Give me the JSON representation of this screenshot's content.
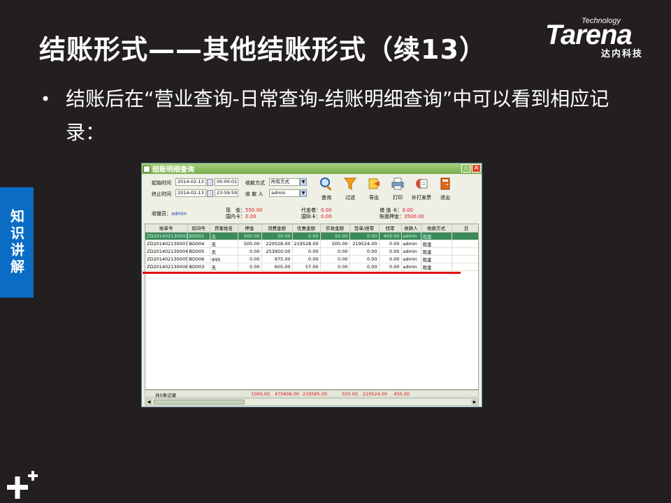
{
  "slide": {
    "title": "结账形式——其他结账形式（续13）",
    "bullet": "结账后在“营业查询-日常查询-结账明细查询”中可以看到相应记录：",
    "side_tab": "知识讲解"
  },
  "logo": {
    "tagline": "Technology",
    "wordmark": "Tarena",
    "cn": "达内科技"
  },
  "window": {
    "title": "结账明细查询",
    "filters": {
      "start_label": "起始时间",
      "start_date": "2014-02-13",
      "start_time": "00:00:01",
      "end_label": "终止时间",
      "end_date": "2014-02-13",
      "end_time": "23:59:59",
      "pay_method_label": "收款方式",
      "pay_method_value": "所有方式",
      "payee_label": "收 款 人",
      "payee_value": "admin",
      "cashier_label": "收银员：",
      "cashier_value": "admin"
    },
    "toolbar": [
      {
        "label": "查询",
        "icon": "magnifier-icon"
      },
      {
        "label": "过滤",
        "icon": "funnel-icon"
      },
      {
        "label": "导出",
        "icon": "export-icon"
      },
      {
        "label": "打印",
        "icon": "printer-icon"
      },
      {
        "label": "补打发票",
        "icon": "invoice-icon"
      },
      {
        "label": "退出",
        "icon": "exit-door-icon"
      }
    ],
    "summary": {
      "cash_label": "现　金：",
      "cash_value": "550.00",
      "domestic_label": "国内卡：",
      "domestic_value": "0.00",
      "voucher_label": "代金卷：",
      "voucher_value": "0.00",
      "intl_label": "国际卡：",
      "intl_value": "0.00",
      "stored_label": "储 值 卡：",
      "stored_value": "0.00",
      "deposit_label": "账面押金：",
      "deposit_value": "3500.00"
    },
    "columns": [
      "账单号",
      "房间号",
      "宾客姓名",
      "押金",
      "消费金额",
      "优惠金额",
      "实收金额",
      "签单/挂零",
      "找零",
      "收款人",
      "收款方式",
      "日"
    ],
    "rows": [
      [
        "ZD201402130002",
        "BD001",
        "无",
        "500.00",
        "50.00",
        "0.00",
        "50.00",
        "0.00",
        "450.00",
        "admin",
        "现金"
      ],
      [
        "ZD201402130003",
        "BD004",
        "无",
        "500.00",
        "220028.00",
        "219528.00",
        "500.00",
        "219524.00",
        "0.00",
        "admin",
        "现金"
      ],
      [
        "ZD201402130004",
        "BD005",
        "无",
        "0.00",
        "253950.00",
        "0.00",
        "0.00",
        "0.00",
        "0.00",
        "admin",
        "现金"
      ],
      [
        "ZD201402130005",
        "BD006",
        "qqq",
        "0.00",
        "975.00",
        "0.00",
        "0.00",
        "0.00",
        "0.00",
        "admin",
        "现金"
      ],
      [
        "ZD201402130006",
        "BD003",
        "无",
        "0.00",
        "605.00",
        "57.00",
        "0.00",
        "0.00",
        "0.00",
        "admin",
        "现金"
      ]
    ],
    "footer": {
      "count_label": "共5条记录",
      "deposit": "1000.00",
      "consume": "475608.00",
      "discount": "219585.00",
      "received": "550.00",
      "signed": "219524.00",
      "change": "450.00"
    },
    "colors": {
      "selected_row": "#3a8a5a",
      "title_bar": "#7bae4f",
      "highlight_line": "#e01010"
    }
  }
}
